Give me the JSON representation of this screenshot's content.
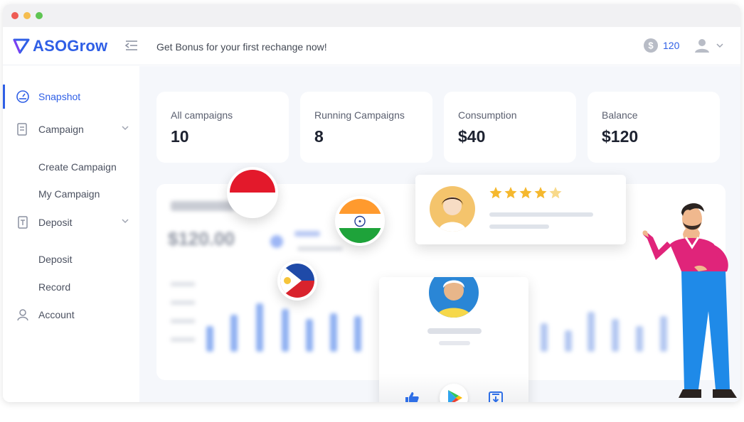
{
  "window": {
    "dots": [
      "#ee5c54",
      "#f5bd4f",
      "#5fc553"
    ]
  },
  "header": {
    "logo": "ASOGrow",
    "banner": "Get Bonus for your first rechange now!",
    "coin_amount": "120"
  },
  "sidebar": {
    "items": [
      {
        "label": "Snapshot",
        "icon": "dashboard-icon",
        "active": true
      },
      {
        "label": "Campaign",
        "icon": "document-icon",
        "expanded": true,
        "children": [
          "Create Campaign",
          "My Campaign"
        ]
      },
      {
        "label": "Deposit",
        "icon": "receipt-icon",
        "expanded": true,
        "children": [
          "Deposit",
          "Record"
        ]
      },
      {
        "label": "Account",
        "icon": "user-icon"
      }
    ]
  },
  "stats": [
    {
      "label": "All campaigns",
      "value": "10"
    },
    {
      "label": "Running Campaigns",
      "value": "8"
    },
    {
      "label": "Consumption",
      "value": "$40"
    },
    {
      "label": "Balance",
      "value": "$120"
    }
  ],
  "revenue": {
    "amount": "$120.00"
  },
  "review": {
    "rating": 4.5,
    "max": 5
  },
  "colors": {
    "accent": "#2f5fe6",
    "star": "#f5b82e",
    "figure_shirt": "#e0247a",
    "figure_pants": "#1f8ae8"
  }
}
